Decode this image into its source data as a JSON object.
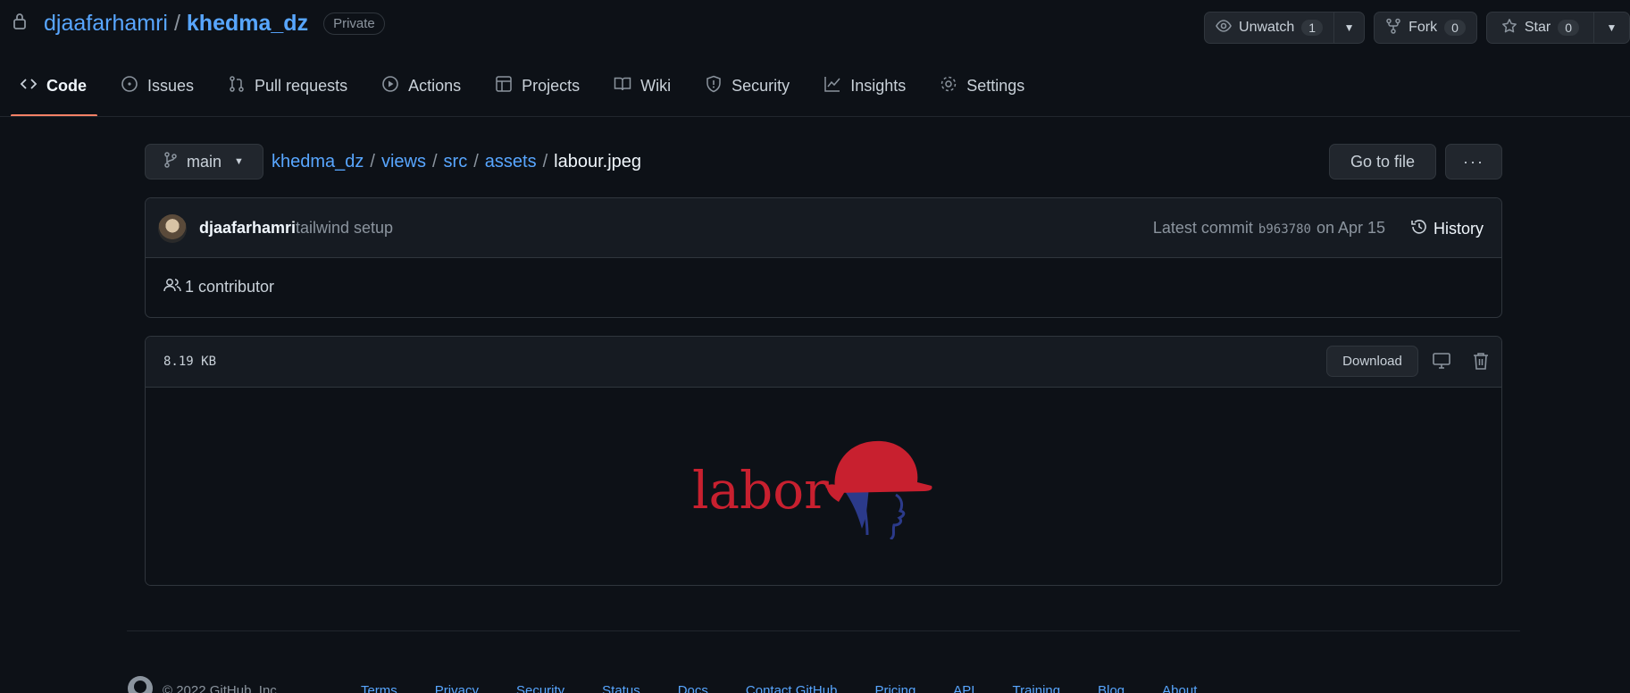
{
  "repo": {
    "owner": "djaafarhamri",
    "separator": "/",
    "name": "khedma_dz",
    "visibility": "Private"
  },
  "header_actions": {
    "unwatch_label": "Unwatch",
    "unwatch_count": "1",
    "fork_label": "Fork",
    "fork_count": "0",
    "star_label": "Star",
    "star_count": "0"
  },
  "tabs": [
    {
      "label": "Code",
      "icon": "code-icon",
      "active": true
    },
    {
      "label": "Issues",
      "icon": "issue-opened-icon"
    },
    {
      "label": "Pull requests",
      "icon": "git-pull-request-icon"
    },
    {
      "label": "Actions",
      "icon": "play-icon"
    },
    {
      "label": "Projects",
      "icon": "table-icon"
    },
    {
      "label": "Wiki",
      "icon": "book-icon"
    },
    {
      "label": "Security",
      "icon": "shield-icon"
    },
    {
      "label": "Insights",
      "icon": "graph-icon"
    },
    {
      "label": "Settings",
      "icon": "gear-icon"
    }
  ],
  "branch": {
    "label": "main"
  },
  "breadcrumb": {
    "parts": [
      "khedma_dz",
      "views",
      "src",
      "assets"
    ],
    "separator": "/",
    "current": "labour.jpeg"
  },
  "toolbar": {
    "goto_label": "Go to file",
    "more_label": "···"
  },
  "commit": {
    "author": "djaafarhamri",
    "message": "tailwind setup",
    "latest_prefix": "Latest commit",
    "sha": "b963780",
    "date": "on Apr 15",
    "history_label": "History"
  },
  "contributors": {
    "label": "1 contributor"
  },
  "file": {
    "size": "8.19 KB",
    "download_label": "Download"
  },
  "footer": {
    "copyright": "© 2022 GitHub, Inc.",
    "links": [
      "Terms",
      "Privacy",
      "Security",
      "Status",
      "Docs",
      "Contact GitHub",
      "Pricing",
      "API",
      "Training",
      "Blog",
      "About"
    ]
  },
  "colors": {
    "background": "#0d1117",
    "link": "#58a6ff",
    "active_tab_underline": "#f78166",
    "labor_red": "#c8202f",
    "labor_blue": "#2b3a8a"
  }
}
